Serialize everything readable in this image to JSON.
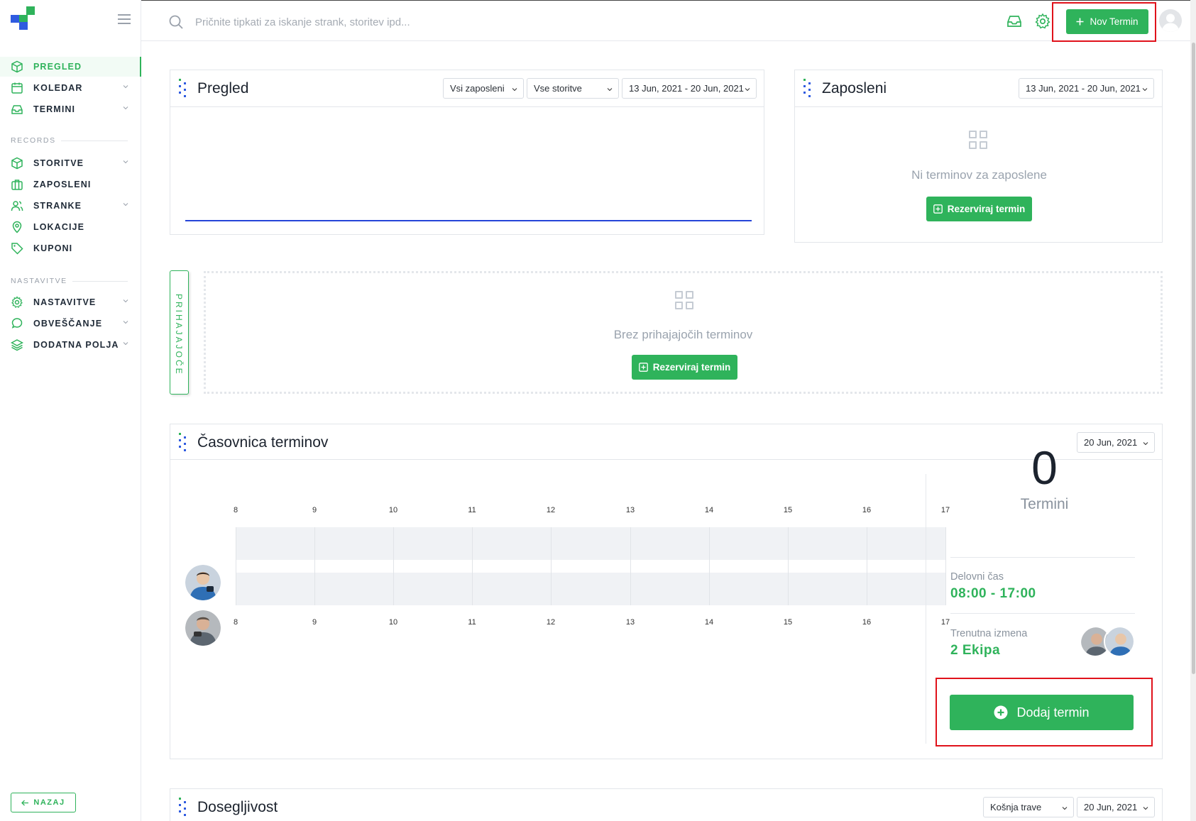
{
  "sidebar": {
    "items": [
      {
        "label": "PREGLED"
      },
      {
        "label": "KOLEDAR"
      },
      {
        "label": "TERMINI"
      },
      {
        "label": "STORITVE"
      },
      {
        "label": "ZAPOSLENI"
      },
      {
        "label": "STRANKE"
      },
      {
        "label": "LOKACIJE"
      },
      {
        "label": "KUPONI"
      },
      {
        "label": "NASTAVITVE"
      },
      {
        "label": "OBVEŠČANJE"
      },
      {
        "label": "DODATNA POLJA"
      }
    ],
    "section_records": "RECORDS",
    "section_settings": "NASTAVITVE",
    "back_label": "NAZAJ"
  },
  "topbar": {
    "search_placeholder": "Pričnite tipkati za iskanje strank, storitev ipd...",
    "new_button_label": "Nov Termin"
  },
  "overview": {
    "title": "Pregled",
    "filter_employees": "Vsi zaposleni",
    "filter_services": "Vse storitve",
    "date_range": "13 Jun, 2021 - 20 Jun, 2021"
  },
  "employees": {
    "title": "Zaposleni",
    "date_range": "13 Jun, 2021 - 20 Jun, 2021",
    "empty_text": "Ni terminov za zaposlene",
    "reserve_label": "Rezerviraj termin"
  },
  "upcoming": {
    "tab_label": "PRIHAJAJOČE",
    "empty_text": "Brez prihajajočih terminov",
    "reserve_label": "Rezerviraj termin"
  },
  "timeline": {
    "title": "Časovnica terminov",
    "date": "20 Jun, 2021",
    "hours": [
      "8",
      "9",
      "10",
      "11",
      "12",
      "13",
      "14",
      "15",
      "16",
      "17"
    ],
    "count": "0",
    "count_label": "Termini",
    "work_time_label": "Delovni čas",
    "work_time_value": "08:00 - 17:00",
    "shift_label": "Trenutna izmena",
    "shift_value": "2 Ekipa",
    "add_label": "Dodaj termin"
  },
  "availability": {
    "title": "Dosegljivost",
    "service": "Košnja trave",
    "date": "20 Jun, 2021"
  },
  "colors": {
    "accent": "#2fb35b",
    "highlight": "#e0121b",
    "chart_line": "#2545d8"
  }
}
